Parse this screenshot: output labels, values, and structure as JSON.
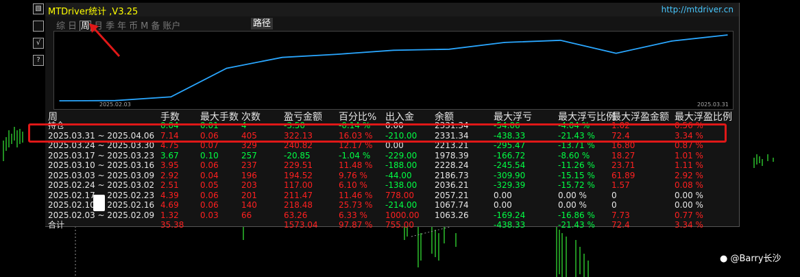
{
  "app": {
    "title": "MTDriver统计 ,V3.25",
    "url": "http://mtdriver.cn"
  },
  "tools": [
    {
      "icon": "chart-icon",
      "glyph": "▧"
    },
    {
      "icon": "blank-tool",
      "glyph": ""
    },
    {
      "icon": "check-icon",
      "glyph": "√"
    },
    {
      "icon": "help-icon",
      "glyph": "?"
    }
  ],
  "tabs": [
    "综",
    "日",
    "周",
    "月",
    "季",
    "年",
    "币",
    "M",
    "备",
    "账户"
  ],
  "active_tab": "周",
  "path_button": "路径",
  "equity_chart": {
    "start_label": "2025.02.03",
    "end_label": "2025.03.31",
    "line_color": "#2aa7ff",
    "points": [
      1063.26,
      1067.74,
      1138,
      1690,
      1900,
      1960,
      2036.21,
      2057.21,
      2186.73,
      2228.24,
      1978.39,
      2213.21,
      2331.34
    ]
  },
  "columns": [
    "周",
    "手数",
    "最大手数",
    "次数",
    "盈亏金额",
    "百分比%",
    "出入金",
    "余额",
    "最大浮亏",
    "最大浮亏比例",
    "最大浮盈金额",
    "最大浮盈比例"
  ],
  "rows": [
    {
      "week": "持仓",
      "lots": "0.04",
      "max_lots": "0.01",
      "count": "4",
      "pnl": "-3.50",
      "pct": "-0.14 %",
      "flow": "0.00",
      "balance": "2331.34",
      "max_dd": "-54.06",
      "max_dd_pct": "-4.04 %",
      "max_fp": "1.02",
      "max_fp_pct": "0.56 %",
      "color": "g"
    },
    {
      "week": "2025.03.31 ~ 2025.04.06",
      "lots": "7.14",
      "max_lots": "0.06",
      "count": "405",
      "pnl": "322.13",
      "pct": "16.03 %",
      "flow": "-210.00",
      "balance": "2331.34",
      "max_dd": "-438.33",
      "max_dd_pct": "-21.43 %",
      "max_fp": "72.4",
      "max_fp_pct": "3.34 %",
      "color": "r"
    },
    {
      "week": "2025.03.24 ~ 2025.03.30",
      "lots": "4.75",
      "max_lots": "0.07",
      "count": "329",
      "pnl": "240.82",
      "pct": "12.17 %",
      "flow": "0.00",
      "balance": "2213.21",
      "max_dd": "-295.47",
      "max_dd_pct": "-13.71 %",
      "max_fp": "16.80",
      "max_fp_pct": "0.87 %",
      "color": "r"
    },
    {
      "week": "2025.03.17 ~ 2025.03.23",
      "lots": "3.67",
      "max_lots": "0.10",
      "count": "257",
      "pnl": "-20.85",
      "pct": "-1.04 %",
      "flow": "-229.00",
      "balance": "1978.39",
      "max_dd": "-166.72",
      "max_dd_pct": "-8.60 %",
      "max_fp": "18.27",
      "max_fp_pct": "1.01 %",
      "color": "g"
    },
    {
      "week": "2025.03.10 ~ 2025.03.16",
      "lots": "3.95",
      "max_lots": "0.06",
      "count": "237",
      "pnl": "229.51",
      "pct": "11.48 %",
      "flow": "-188.00",
      "balance": "2228.24",
      "max_dd": "-245.54",
      "max_dd_pct": "-11.26 %",
      "max_fp": "23.71",
      "max_fp_pct": "1.11 %",
      "color": "r"
    },
    {
      "week": "2025.03.03 ~ 2025.03.09",
      "lots": "2.92",
      "max_lots": "0.04",
      "count": "196",
      "pnl": "194.52",
      "pct": "9.76 %",
      "flow": "-44.00",
      "balance": "2186.73",
      "max_dd": "-309.90",
      "max_dd_pct": "-15.15 %",
      "max_fp": "61.89",
      "max_fp_pct": "2.92 %",
      "color": "r"
    },
    {
      "week": "2025.02.24 ~ 2025.03.02",
      "lots": "2.51",
      "max_lots": "0.05",
      "count": "203",
      "pnl": "117.00",
      "pct": "6.10 %",
      "flow": "-138.00",
      "balance": "2036.21",
      "max_dd": "-329.39",
      "max_dd_pct": "-15.72 %",
      "max_fp": "1.57",
      "max_fp_pct": "0.08 %",
      "color": "r"
    },
    {
      "week": "2025.02.17 ~ 2025.02.23",
      "lots": "4.39",
      "max_lots": "0.06",
      "count": "201",
      "pnl": "211.47",
      "pct": "11.46 %",
      "flow": "778.00",
      "balance": "2057.21",
      "max_dd": "0.00",
      "max_dd_pct": "0.00 %",
      "max_fp": "0",
      "max_fp_pct": "0.00 %",
      "color": "r"
    },
    {
      "week": "2025.02.10 ~ 2025.02.16",
      "lots": "4.69",
      "max_lots": "0.06",
      "count": "140",
      "pnl": "218.48",
      "pct": "25.73 %",
      "flow": "-214.00",
      "balance": "1067.74",
      "max_dd": "0.00",
      "max_dd_pct": "0.00 %",
      "max_fp": "0",
      "max_fp_pct": "0.00 %",
      "color": "r"
    },
    {
      "week": "2025.02.03 ~ 2025.02.09",
      "lots": "1.32",
      "max_lots": "0.03",
      "count": "66",
      "pnl": "63.26",
      "pct": "6.33 %",
      "flow": "1000.00",
      "balance": "1063.26",
      "max_dd": "-169.24",
      "max_dd_pct": "-16.86 %",
      "max_fp": "7.73",
      "max_fp_pct": "0.77 %",
      "color": "r"
    }
  ],
  "total": {
    "week": "合计",
    "lots": "35.38",
    "pnl": "1573.04",
    "pct": "97.87 %",
    "flow": "755.00",
    "max_dd": "-438.33",
    "max_dd_pct": "-21.43 %",
    "max_fp": "72.4",
    "max_fp_pct": "3.34 %"
  },
  "watermark": "@Barry长沙",
  "colors": {
    "positive": "#ff2020",
    "negative": "#00ff44",
    "title": "#ffff00",
    "link": "#48c8ff",
    "highlight": "#e01818"
  }
}
